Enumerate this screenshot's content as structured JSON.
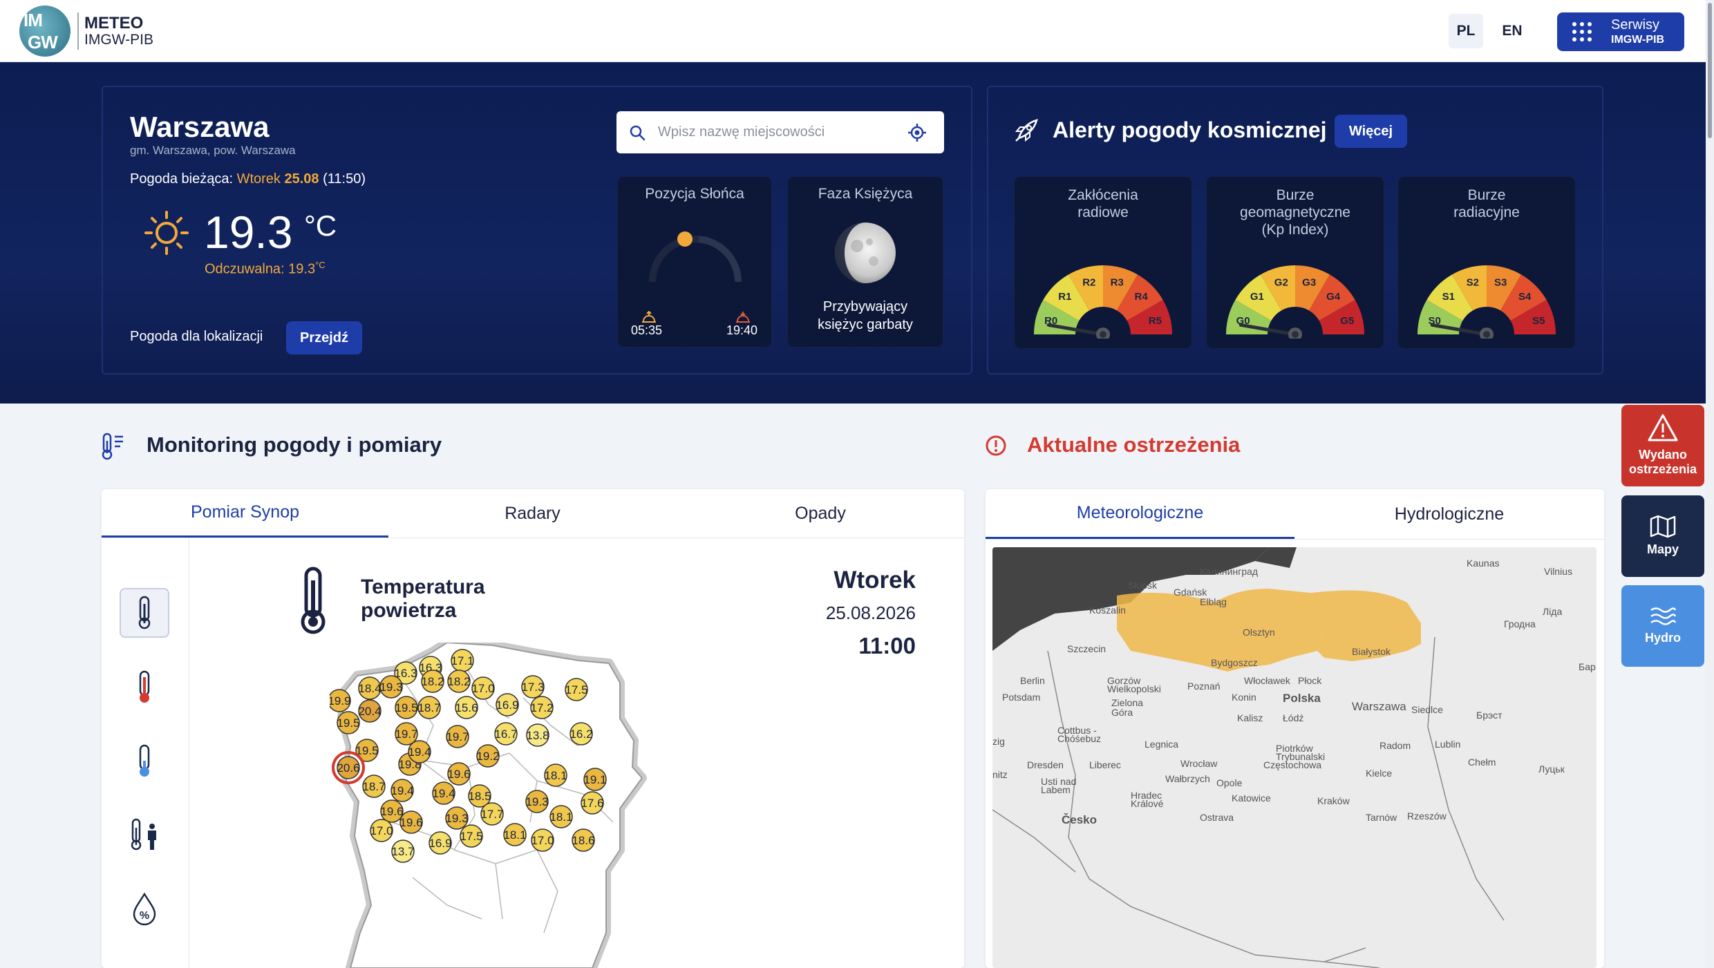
{
  "header": {
    "logo_text_top": "METEO",
    "logo_text_bottom": "IMGW-PIB",
    "logo_mark": "IMGW",
    "lang_pl": "PL",
    "lang_en": "EN",
    "services_line1": "Serwisy",
    "services_line2": "IMGW-PIB"
  },
  "hero": {
    "city": "Warszawa",
    "city_sub": "gm. Warszawa, pow. Warszawa",
    "current_label": "Pogoda bieżąca:",
    "current_day": "Wtorek",
    "current_date": "25.08",
    "current_time": "(11:50)",
    "temperature": "19.3",
    "temperature_unit": "°C",
    "feels_label": "Odczuwalna: 19.3",
    "feels_unit": "°C",
    "location_label": "Pogoda dla lokalizacji",
    "location_button": "Przejdź",
    "search_placeholder": "Wpisz nazwę miejscowości",
    "sun_card_title": "Pozycja Słońca",
    "sunrise": "05:35",
    "sunset": "19:40",
    "moon_card_title": "Faza Księżyca",
    "moon_phase_line1": "Przybywający",
    "moon_phase_line2": "księżyc garbaty",
    "alerts_title": "Alerty pogody kosmicznej",
    "alerts_button": "Więcej",
    "gauges": [
      {
        "title_line1": "Zakłócenia",
        "title_line2": "radiowe",
        "title_line3": "",
        "labels": [
          "R0",
          "R1",
          "R2",
          "R3",
          "R4",
          "R5"
        ],
        "level": 0
      },
      {
        "title_line1": "Burze",
        "title_line2": "geomagnetyczne",
        "title_line3": "(Kp Index)",
        "labels": [
          "G0",
          "G1",
          "G2",
          "G3",
          "G4",
          "G5"
        ],
        "level": 0
      },
      {
        "title_line1": "Burze",
        "title_line2": "radiacyjne",
        "title_line3": "",
        "labels": [
          "S0",
          "S1",
          "S2",
          "S3",
          "S4",
          "S5"
        ],
        "level": 0
      }
    ]
  },
  "monitoring": {
    "title": "Monitoring pogody i pomiary",
    "tabs": [
      "Pomiar Synop",
      "Radary",
      "Opady"
    ],
    "active_tab": "Pomiar Synop",
    "map_title_line1": "Temperatura",
    "map_title_line2": "powietrza",
    "map_day": "Wtorek",
    "map_date": "25.08.2026",
    "map_time": "11:00",
    "side_icons": [
      "thermometer-icon",
      "thermometer-max-icon",
      "thermometer-min-icon",
      "feels-like-icon",
      "humidity-icon"
    ],
    "readings": [
      "16.3",
      "16.3",
      "17.1",
      "19.9",
      "18.4",
      "19.3",
      "18.2",
      "18.2",
      "17.0",
      "17.3",
      "17.5",
      "20.4",
      "19.5",
      "18.7",
      "15.6",
      "16.9",
      "17.2",
      "19.5",
      "19.7",
      "19.7",
      "16.7",
      "13.8",
      "16.2",
      "19.5",
      "19.2",
      "20.6",
      "19.8",
      "19.6",
      "19.4",
      "18.1",
      "19.1",
      "18.7",
      "19.4",
      "19.4",
      "18.5",
      "19.3",
      "17.6",
      "19.6",
      "17.7",
      "18.1",
      "19.6",
      "19.3",
      "17.0",
      "17.5",
      "18.1",
      "17.0",
      "18.6",
      "16.9",
      "13.7"
    ],
    "highlight": "20.6"
  },
  "warnings": {
    "title": "Aktualne ostrzeżenia",
    "tabs": [
      "Meteorologiczne",
      "Hydrologiczne"
    ],
    "active_tab": "Meteorologiczne",
    "map_labels": [
      "Калининград",
      "Słupsk",
      "Gdańsk",
      "Elbląg",
      "Koszalin",
      "Olsztyn",
      "Kaunas",
      "Vilnius",
      "Szczecin",
      "Bydgoszcz",
      "Białystok",
      "Гродна",
      "Berlin",
      "Gorzów Wielkopolski",
      "Poznań",
      "Włocławek",
      "Płock",
      "Potsdam",
      "Zielona Góra",
      "Konin",
      "Polska",
      "Warszawa",
      "Siedlce",
      "Kalisz",
      "Łódź",
      "Брэст",
      "Cottbus - Chóśebuz",
      "Legnica",
      "Radom",
      "Lublin",
      "Dresden",
      "Wrocław",
      "Piotrków Trybunalski",
      "Chełm",
      "Liberec",
      "Częstochowa",
      "Kielce",
      "Wałbrzych",
      "Usti nad Labem",
      "Opole",
      "Hradec Králové",
      "Katowice",
      "Kraków",
      "Tarnów",
      "Rzeszów",
      "Česko",
      "Ostrava",
      "Луцьк",
      "Ліда",
      "Бар",
      "zig",
      "nitz"
    ]
  },
  "floating": {
    "warning_line1": "Wydano",
    "warning_line2": "ostrzeżenia",
    "maps": "Mapy",
    "hydro": "Hydro"
  },
  "colors": {
    "navy": "#12245e",
    "primary": "#1f3da8",
    "orange": "#f2a93b",
    "warning_red": "#c8342c",
    "hydro_blue": "#4b8fe0",
    "warning_area": "#f0b84a"
  }
}
